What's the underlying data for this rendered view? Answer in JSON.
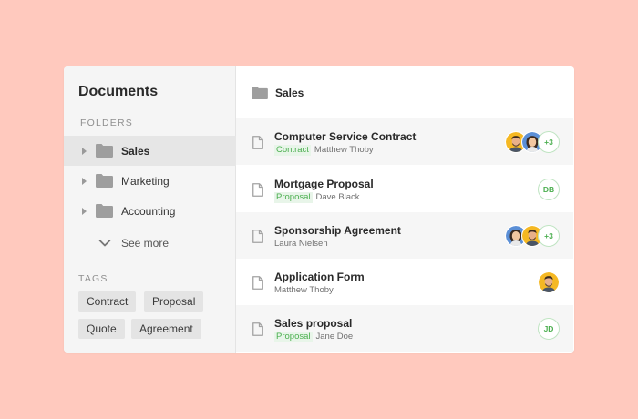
{
  "sidebar": {
    "title": "Documents",
    "folders_label": "FOLDERS",
    "folders": [
      {
        "label": "Sales",
        "active": true
      },
      {
        "label": "Marketing",
        "active": false
      },
      {
        "label": "Accounting",
        "active": false
      }
    ],
    "see_more": "See more",
    "tags_label": "TAGS",
    "tags": [
      "Contract",
      "Proposal",
      "Quote",
      "Agreement"
    ]
  },
  "main": {
    "folder_title": "Sales",
    "documents": [
      {
        "title": "Computer Service Contract",
        "tag": "Contract",
        "person": "Matthew Thoby",
        "avatars": [
          "man-avatar",
          "woman-avatar"
        ],
        "extra": "+3"
      },
      {
        "title": "Mortgage Proposal",
        "tag": "Proposal",
        "person": "Dave Black",
        "initials": "DB"
      },
      {
        "title": "Sponsorship Agreement",
        "tag": "",
        "person": "Laura Nielsen",
        "avatars": [
          "woman-avatar",
          "man-avatar"
        ],
        "extra": "+3"
      },
      {
        "title": "Application Form",
        "tag": "",
        "person": "Matthew Thoby",
        "avatars": [
          "man-avatar"
        ]
      },
      {
        "title": "Sales proposal",
        "tag": "Proposal",
        "person": "Jane Doe",
        "initials": "JD"
      }
    ]
  },
  "colors": {
    "background": "#FFC9BE",
    "accent_green": "#4caf50",
    "tag_green_bg": "#e8f5e9"
  }
}
